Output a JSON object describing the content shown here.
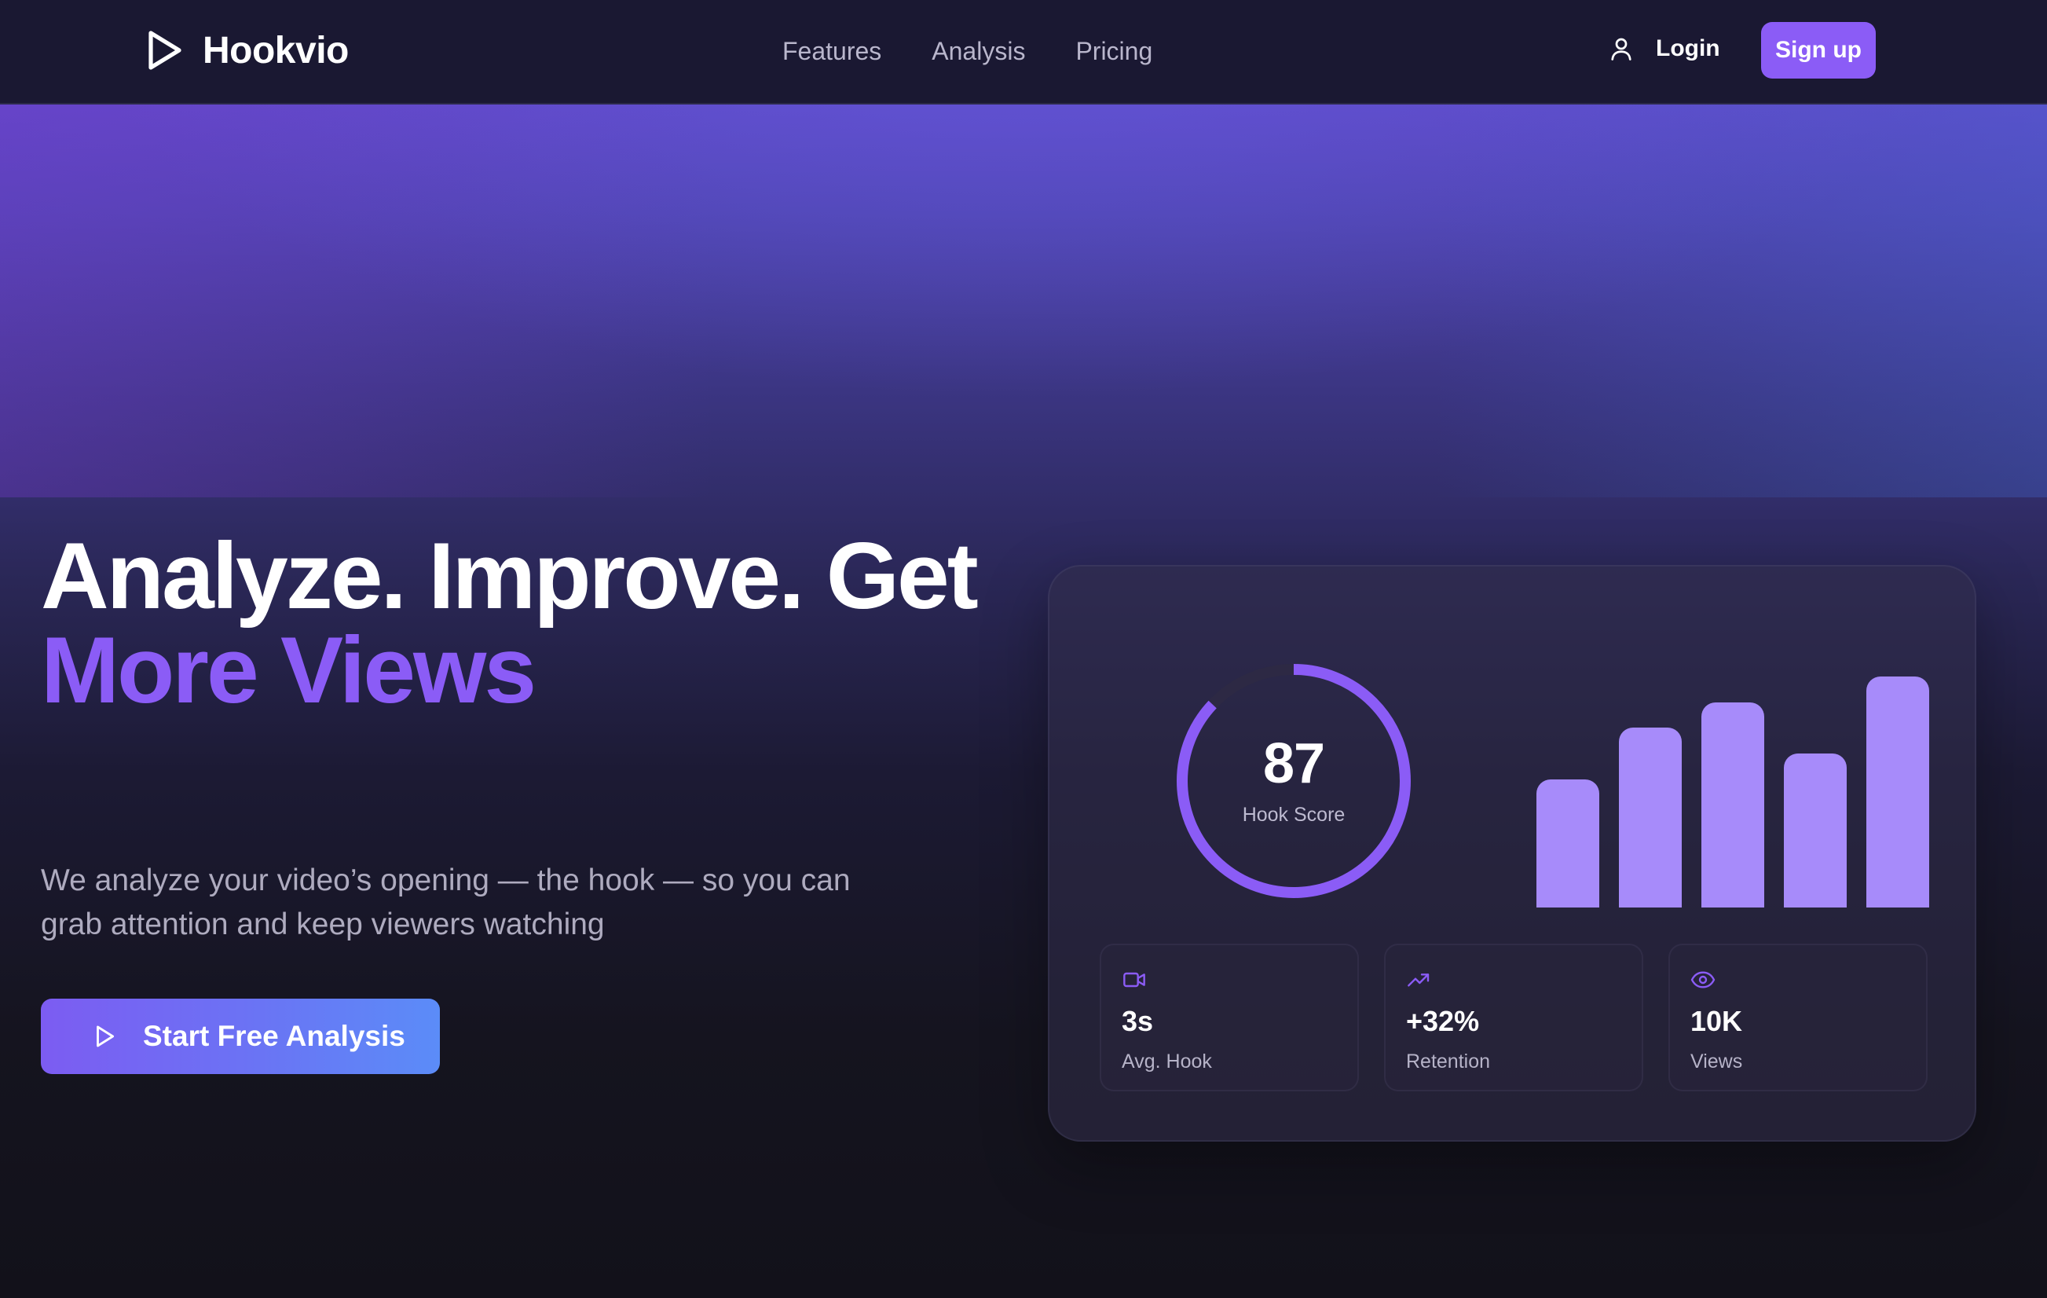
{
  "nav": {
    "brand": "Hookvio",
    "links": [
      "Features",
      "Analysis",
      "Pricing"
    ],
    "login_label": "Login",
    "signup_label": "Sign up"
  },
  "hero": {
    "headline_line1": "Analyze. Improve. Get",
    "headline_line2": "More Views",
    "subtitle": "We analyze your video’s opening — the hook — so you can grab attention and keep viewers watching",
    "cta_label": "Start Free Analysis"
  },
  "card": {
    "gauge": {
      "value": "87",
      "label": "Hook Score",
      "fraction": 0.87
    },
    "bars": [
      0.5,
      0.7,
      0.8,
      0.6,
      0.9
    ],
    "stats": [
      {
        "icon": "video-camera-icon",
        "value": "3s",
        "label": "Avg. Hook"
      },
      {
        "icon": "trending-up-icon",
        "value": "+32%",
        "label": "Retention"
      },
      {
        "icon": "eye-icon",
        "value": "10K",
        "label": "Views"
      }
    ]
  },
  "colors": {
    "accent": "#8b5cf6",
    "bar": "#a78bfa",
    "nav_background": "#1a1832",
    "cta_gradient_start": "#7c5cf2",
    "cta_gradient_end": "#5b8cf8"
  }
}
